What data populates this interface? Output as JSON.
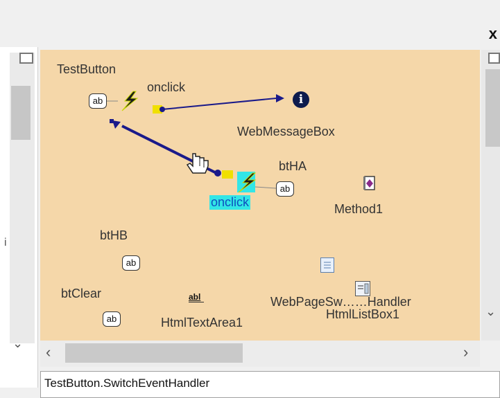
{
  "window": {
    "close_glyph": "x"
  },
  "left_panel": {
    "marker": "i"
  },
  "canvas": {
    "components": [
      {
        "id": "TestButton",
        "label": "TestButton",
        "icon": "ab"
      },
      {
        "id": "WebMessageBox",
        "label": "WebMessageBox",
        "icon": "info-icon"
      },
      {
        "id": "btHA",
        "label": "btHA",
        "icon": "ab"
      },
      {
        "id": "Method1",
        "label": "Method1",
        "icon": "method-icon"
      },
      {
        "id": "btHB",
        "label": "btHB",
        "icon": "ab"
      },
      {
        "id": "btClear",
        "label": "btClear",
        "icon": "ab"
      },
      {
        "id": "HtmlTextArea1",
        "label": "HtmlTextArea1",
        "icon": "abl"
      },
      {
        "id": "WebPageSwitchHandler",
        "label": "WebPageSw……Handler",
        "icon": "page-icon"
      },
      {
        "id": "HtmlListBox1",
        "label": "HtmlListBox1",
        "icon": "listbox-icon"
      }
    ],
    "events": {
      "testbutton_onclick": "onclick",
      "btha_onclick": "onclick"
    }
  },
  "status_bar": {
    "text": "TestButton.SwitchEventHandler"
  },
  "colors": {
    "canvas_bg": "#f5d7a9",
    "connector": "#1a1a8a",
    "event_highlight": "#33e6e6",
    "method_purple": "#8a2a8a"
  }
}
